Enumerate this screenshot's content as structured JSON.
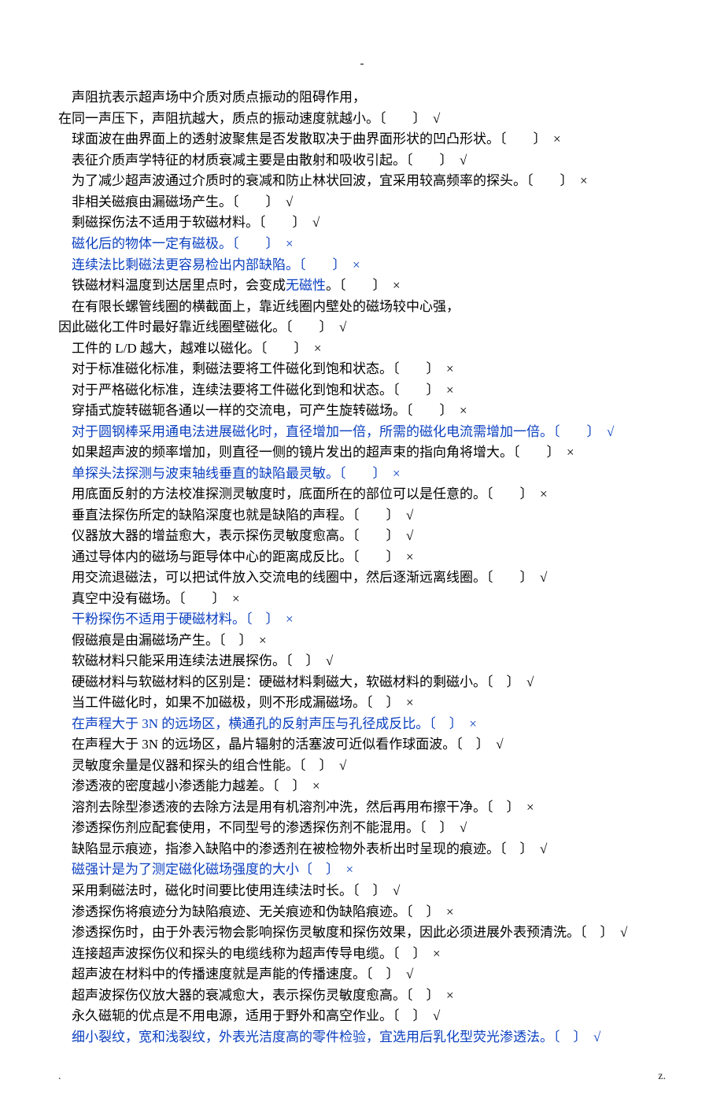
{
  "topMark": "-",
  "lines": [
    {
      "indent": true,
      "blue": false,
      "text": "声阻抗表示超声场中介质对质点振动的阻碍作用，"
    },
    {
      "indent": false,
      "blue": false,
      "text": "在同一声压下，声阻抗越大，质点的振动速度就越小。〔　　〕　√"
    },
    {
      "indent": true,
      "blue": false,
      "text": "球面波在曲界面上的透射波聚焦是否发散取决于曲界面形状的凹凸形状。〔　　〕　×"
    },
    {
      "indent": true,
      "blue": false,
      "text": "表征介质声学特征的材质衰减主要是由散射和吸收引起。〔　　〕　√"
    },
    {
      "indent": true,
      "blue": false,
      "text": "为了减少超声波通过介质时的衰减和防止林状回波，宜采用较高频率的探头。〔　　〕　×"
    },
    {
      "indent": true,
      "blue": false,
      "text": "非相关磁痕由漏磁场产生。〔　　〕　√"
    },
    {
      "indent": true,
      "blue": false,
      "text": "剩磁探伤法不适用于软磁材料。〔　　〕　√"
    },
    {
      "indent": true,
      "blue": true,
      "text": "磁化后的物体一定有磁极。〔　　〕　×"
    },
    {
      "indent": true,
      "blue": true,
      "text": "连续法比剩磁法更容易检出内部缺陷。〔　　〕　×"
    },
    {
      "indent": true,
      "blue": false,
      "prefix": "铁磁材料温度到达居里点时，会变成",
      "blueFrag": "无磁性",
      "suffix": "。〔　　〕　×"
    },
    {
      "indent": true,
      "blue": false,
      "text": "在有限长螺管线圈的横截面上，靠近线圈内壁处的磁场较中心强，"
    },
    {
      "indent": false,
      "blue": false,
      "text": "因此磁化工件时最好靠近线圈壁磁化。〔　　〕　√"
    },
    {
      "indent": true,
      "blue": false,
      "text": "工件的 L/D 越大，越难以磁化。〔　　〕　×"
    },
    {
      "indent": true,
      "blue": false,
      "text": "对于标准磁化标准，剩磁法要将工件磁化到饱和状态。〔　　〕　×"
    },
    {
      "indent": true,
      "blue": false,
      "text": "对于严格磁化标准，连续法要将工件磁化到饱和状态。〔　　〕　×"
    },
    {
      "indent": true,
      "blue": false,
      "text": "穿插式旋转磁轭各通以一样的交流电，可产生旋转磁场。〔　　〕　×"
    },
    {
      "indent": true,
      "blue": true,
      "text": "对于圆钢棒采用通电法进展磁化时，直径增加一倍，所需的磁化电流需增加一倍。〔　　〕　√"
    },
    {
      "indent": true,
      "blue": false,
      "text": "如果超声波的频率增加，则直径一侧的镜片发出的超声束的指向角将增大。〔　　〕　×"
    },
    {
      "indent": true,
      "blue": true,
      "text": "单探头法探测与波束轴线垂直的缺陷最灵敏。〔　　〕　×"
    },
    {
      "indent": true,
      "blue": false,
      "text": "用底面反射的方法校准探测灵敏度时，底面所在的部位可以是任意的。〔　　〕　×"
    },
    {
      "indent": true,
      "blue": false,
      "text": "垂直法探伤所定的缺陷深度也就是缺陷的声程。〔　　〕　√"
    },
    {
      "indent": true,
      "blue": false,
      "text": "仪器放大器的增益愈大，表示探伤灵敏度愈高。〔　　〕　√"
    },
    {
      "indent": true,
      "blue": false,
      "text": "通过导体内的磁场与距导体中心的距离成反比。〔　　〕　×"
    },
    {
      "indent": true,
      "blue": false,
      "text": "用交流退磁法，可以把试件放入交流电的线圈中，然后逐渐远离线圈。〔　　〕　√"
    },
    {
      "indent": true,
      "blue": false,
      "text": "真空中没有磁场。〔　　〕　×"
    },
    {
      "indent": true,
      "blue": true,
      "text": "干粉探伤不适用于硬磁材料。〔　〕　×"
    },
    {
      "indent": true,
      "blue": false,
      "text": "假磁痕是由漏磁场产生。〔　〕　×"
    },
    {
      "indent": true,
      "blue": false,
      "text": "软磁材料只能采用连续法进展探伤。〔　〕　√"
    },
    {
      "indent": true,
      "blue": false,
      "text": "硬磁材料与软磁材料的区别是：硬磁材料剩磁大，软磁材料的剩磁小。〔　〕　√"
    },
    {
      "indent": true,
      "blue": false,
      "text": "当工件磁化时，如果不加磁极，则不形成漏磁场。〔　〕　×"
    },
    {
      "indent": true,
      "blue": true,
      "text": "在声程大于 3N 的远场区，横通孔的反射声压与孔径成反比。〔　〕　×"
    },
    {
      "indent": true,
      "blue": false,
      "text": "在声程大于 3N 的远场区，晶片辐射的活塞波可近似看作球面波。〔　〕　√"
    },
    {
      "indent": true,
      "blue": false,
      "text": "灵敏度余量是仪器和探头的组合性能。〔　〕　√"
    },
    {
      "indent": true,
      "blue": false,
      "text": "渗透液的密度越小渗透能力越差。〔　〕　×"
    },
    {
      "indent": true,
      "blue": false,
      "text": "溶剂去除型渗透液的去除方法是用有机溶剂冲洗，然后再用布擦干净。〔　〕　×"
    },
    {
      "indent": true,
      "blue": false,
      "text": "渗透探伤剂应配套使用，不同型号的渗透探伤剂不能混用。〔　〕　√"
    },
    {
      "indent": true,
      "blue": false,
      "text": "缺陷显示痕迹，指渗入缺陷中的渗透剂在被检物外表析出时呈现的痕迹。〔　〕　√"
    },
    {
      "indent": true,
      "blue": true,
      "text": "磁强计是为了测定磁化磁场强度的大小〔　〕　×"
    },
    {
      "indent": true,
      "blue": false,
      "text": "采用剩磁法时，磁化时间要比使用连续法时长。〔　〕　√"
    },
    {
      "indent": true,
      "blue": false,
      "text": "渗透探伤将痕迹分为缺陷痕迹、无关痕迹和伪缺陷痕迹。〔　〕　×"
    },
    {
      "indent": true,
      "blue": false,
      "text": "渗透探伤时，由于外表污物会影响探伤灵敏度和探伤效果，因此必须进展外表预清洗。〔　〕　√"
    },
    {
      "indent": true,
      "blue": false,
      "text": "连接超声波探伤仪和探头的电缆线称为超声传导电缆。〔　〕　×"
    },
    {
      "indent": true,
      "blue": false,
      "text": "超声波在材料中的传播速度就是声能的传播速度。〔　〕　√"
    },
    {
      "indent": true,
      "blue": false,
      "text": "超声波探伤仪放大器的衰减愈大，表示探伤灵敏度愈高。〔　〕　×"
    },
    {
      "indent": true,
      "blue": false,
      "text": "永久磁轭的优点是不用电源，适用于野外和高空作业。〔　〕　√"
    },
    {
      "indent": true,
      "blue": true,
      "text": "细小裂纹，宽和浅裂纹，外表光洁度高的零件检验，宜选用后乳化型荧光渗透法。〔　〕　√"
    }
  ],
  "footerLeft": ".",
  "footerRight": "z."
}
